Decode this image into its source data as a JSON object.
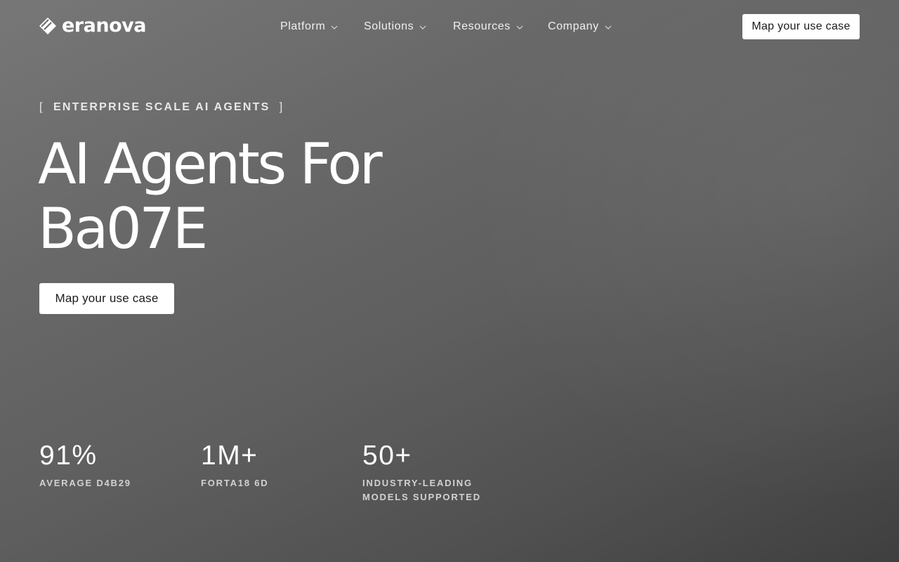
{
  "brand": {
    "name": "eranova"
  },
  "nav": {
    "items": [
      {
        "label": "Platform"
      },
      {
        "label": "Solutions"
      },
      {
        "label": "Resources"
      },
      {
        "label": "Company"
      }
    ],
    "cta_label": "Map your use case"
  },
  "hero": {
    "eyebrow_open": "[",
    "eyebrow_text": "ENTERPRISE SCALE AI AGENTS",
    "eyebrow_close": "]",
    "headline_line1": "AI Agents For",
    "headline_line2": "Ba07E",
    "cta_label": "Map your use case"
  },
  "stats": [
    {
      "value": "91%",
      "label": "AVERAGE D4B29"
    },
    {
      "value": "1M+",
      "label": "FORTA18 6D"
    },
    {
      "value": "50+",
      "label": "INDUSTRY-LEADING MODELS SUPPORTED"
    }
  ],
  "icons": {
    "logo": "diamond-logo-icon",
    "dropdown": "chevron-down-icon"
  },
  "colors": {
    "background_top": "#777777",
    "background_bottom": "#3f3f3f",
    "button_bg": "#ffffff",
    "button_text": "#1a1a1a"
  }
}
